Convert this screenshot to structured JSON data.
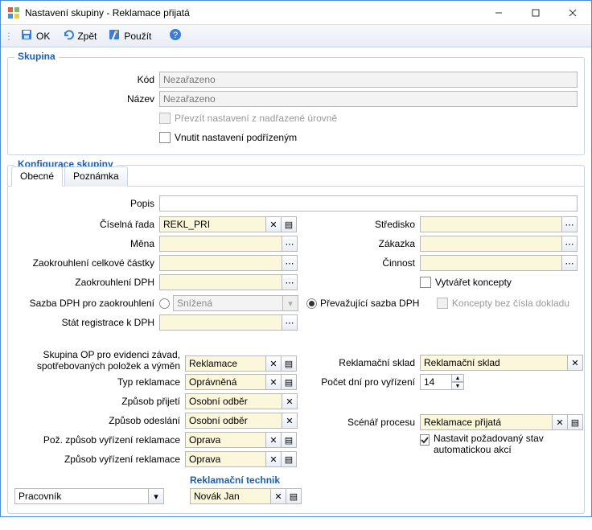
{
  "window": {
    "title": "Nastavení skupiny - Reklamace přijatá"
  },
  "toolbar": {
    "ok": "OK",
    "back": "Zpět",
    "apply": "Použít"
  },
  "group_skupina": {
    "legend": "Skupina",
    "kod_label": "Kód",
    "kod_value": "Nezařazeno",
    "nazev_label": "Název",
    "nazev_value": "Nezařazeno",
    "prevzit_label": "Převzít nastavení z nadřazené úrovně",
    "vnutit_label": "Vnutit nastavení podřízeným"
  },
  "group_konfig": {
    "legend": "Konfigurace skupiny",
    "tabs": {
      "obecne": "Obecné",
      "poznamka": "Poznámka"
    },
    "left": {
      "popis_label": "Popis",
      "popis_value": "",
      "crada_label": "Číselná řada",
      "crada_value": "REKL_PRI",
      "mena_label": "Měna",
      "mena_value": "",
      "zaokcelk_label": "Zaokrouhlení celkové částky",
      "zaokcelk_value": "",
      "zaokdph_label": "Zaokrouhlení DPH",
      "zaokdph_value": "",
      "sazba_label": "Sazba DPH pro zaokrouhlení",
      "sazba_value": "Snížená",
      "prevaz_label": "Převažující sazba DPH",
      "stat_label": "Stát registrace k DPH",
      "stat_value": ""
    },
    "right": {
      "stredisko_label": "Středisko",
      "stredisko_value": "",
      "zakazka_label": "Zákazka",
      "zakazka_value": "",
      "cinnost_label": "Činnost",
      "cinnost_value": "",
      "vytkoncept_label": "Vytvářet koncepty",
      "konceptybez_label": "Koncepty bez čísla dokladu"
    },
    "left2": {
      "skupop_label": "Skupina OP pro evidenci závad, spotřebovaných položek a výměn",
      "skupop_value": "Reklamace",
      "typrekl_label": "Typ reklamace",
      "typrekl_value": "Oprávněná",
      "zpprijeti_label": "Způsob přijetí",
      "zpprijeti_value": "Osobní odběr",
      "zpodeslani_label": "Způsob odeslání",
      "zpodeslani_value": "Osobní odběr",
      "pozvyr_label": "Pož. způsob vyřízení reklamace",
      "pozvyr_value": "Oprava",
      "zpvyr_label": "Způsob vyřízení reklamace",
      "zpvyr_value": "Oprava"
    },
    "right2": {
      "reklsklad_label": "Reklamační sklad",
      "reklsklad_value": "Reklamační sklad",
      "pocetdni_label": "Počet dní pro vyřízení",
      "pocetdni_value": "14",
      "scenar_label": "Scénář procesu",
      "scenar_value": "Reklamace přijatá",
      "nastavit_label": "Nastavit požadovaný stav automatickou akcí"
    },
    "technik": {
      "heading": "Reklamační technik",
      "pracovnik_label": "Pracovník",
      "pracovnik_value": "Novák Jan"
    }
  }
}
